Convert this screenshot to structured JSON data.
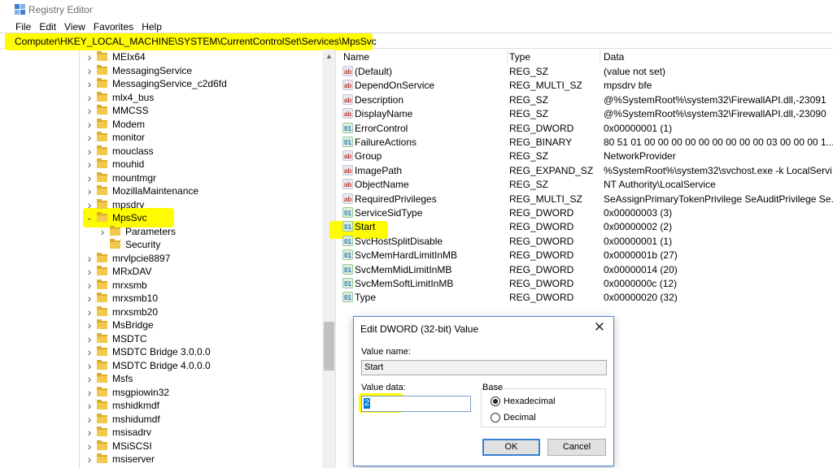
{
  "window": {
    "title": "Registry Editor"
  },
  "menu": {
    "file": "File",
    "edit": "Edit",
    "view": "View",
    "favorites": "Favorites",
    "help": "Help"
  },
  "address": {
    "path": "Computer\\HKEY_LOCAL_MACHINE\\SYSTEM\\CurrentControlSet\\Services\\MpsSvc"
  },
  "tree": {
    "items": [
      {
        "label": "MEIx64",
        "expanded": false,
        "has_children": true
      },
      {
        "label": "MessagingService",
        "expanded": false,
        "has_children": true
      },
      {
        "label": "MessagingService_c2d6fd",
        "expanded": false,
        "has_children": true
      },
      {
        "label": "mlx4_bus",
        "expanded": false,
        "has_children": true
      },
      {
        "label": "MMCSS",
        "expanded": false,
        "has_children": true
      },
      {
        "label": "Modem",
        "expanded": false,
        "has_children": true
      },
      {
        "label": "monitor",
        "expanded": false,
        "has_children": true
      },
      {
        "label": "mouclass",
        "expanded": false,
        "has_children": true
      },
      {
        "label": "mouhid",
        "expanded": false,
        "has_children": true
      },
      {
        "label": "mountmgr",
        "expanded": false,
        "has_children": true
      },
      {
        "label": "MozillaMaintenance",
        "expanded": false,
        "has_children": true
      },
      {
        "label": "mpsdrv",
        "expanded": false,
        "has_children": true
      },
      {
        "label": "MpsSvc",
        "expanded": true,
        "has_children": true,
        "selected": true
      },
      {
        "label": "Parameters",
        "expanded": false,
        "has_children": true,
        "child": true
      },
      {
        "label": "Security",
        "expanded": false,
        "has_children": false,
        "child": true
      },
      {
        "label": "mrvlpcie8897",
        "expanded": false,
        "has_children": true
      },
      {
        "label": "MRxDAV",
        "expanded": false,
        "has_children": true
      },
      {
        "label": "mrxsmb",
        "expanded": false,
        "has_children": true
      },
      {
        "label": "mrxsmb10",
        "expanded": false,
        "has_children": true
      },
      {
        "label": "mrxsmb20",
        "expanded": false,
        "has_children": true
      },
      {
        "label": "MsBridge",
        "expanded": false,
        "has_children": true
      },
      {
        "label": "MSDTC",
        "expanded": false,
        "has_children": true
      },
      {
        "label": "MSDTC Bridge 3.0.0.0",
        "expanded": false,
        "has_children": true
      },
      {
        "label": "MSDTC Bridge 4.0.0.0",
        "expanded": false,
        "has_children": true
      },
      {
        "label": "Msfs",
        "expanded": false,
        "has_children": true
      },
      {
        "label": "msgpiowin32",
        "expanded": false,
        "has_children": true
      },
      {
        "label": "mshidkmdf",
        "expanded": false,
        "has_children": true
      },
      {
        "label": "mshidumdf",
        "expanded": false,
        "has_children": true
      },
      {
        "label": "msisadrv",
        "expanded": false,
        "has_children": true
      },
      {
        "label": "MSiSCSI",
        "expanded": false,
        "has_children": true
      },
      {
        "label": "msiserver",
        "expanded": false,
        "has_children": true
      }
    ]
  },
  "values": {
    "headers": {
      "name": "Name",
      "type": "Type",
      "data": "Data"
    },
    "rows": [
      {
        "name": "(Default)",
        "type": "REG_SZ",
        "data": "(value not set)",
        "icon": "string-value-icon"
      },
      {
        "name": "DependOnService",
        "type": "REG_MULTI_SZ",
        "data": "mpsdrv bfe",
        "icon": "string-value-icon"
      },
      {
        "name": "Description",
        "type": "REG_SZ",
        "data": "@%SystemRoot%\\system32\\FirewallAPI.dll,-23091",
        "icon": "string-value-icon"
      },
      {
        "name": "DisplayName",
        "type": "REG_SZ",
        "data": "@%SystemRoot%\\system32\\FirewallAPI.dll,-23090",
        "icon": "string-value-icon"
      },
      {
        "name": "ErrorControl",
        "type": "REG_DWORD",
        "data": "0x00000001 (1)",
        "icon": "binary-value-icon"
      },
      {
        "name": "FailureActions",
        "type": "REG_BINARY",
        "data": "80 51 01 00 00 00 00 00 00 00 00 00 03 00 00 00 1...",
        "icon": "binary-value-icon"
      },
      {
        "name": "Group",
        "type": "REG_SZ",
        "data": "NetworkProvider",
        "icon": "string-value-icon"
      },
      {
        "name": "ImagePath",
        "type": "REG_EXPAND_SZ",
        "data": "%SystemRoot%\\system32\\svchost.exe -k LocalServi...",
        "icon": "string-value-icon"
      },
      {
        "name": "ObjectName",
        "type": "REG_SZ",
        "data": "NT Authority\\LocalService",
        "icon": "string-value-icon"
      },
      {
        "name": "RequiredPrivileges",
        "type": "REG_MULTI_SZ",
        "data": "SeAssignPrimaryTokenPrivilege SeAuditPrivilege Se...",
        "icon": "string-value-icon"
      },
      {
        "name": "ServiceSidType",
        "type": "REG_DWORD",
        "data": "0x00000003 (3)",
        "icon": "binary-value-icon"
      },
      {
        "name": "Start",
        "type": "REG_DWORD",
        "data": "0x00000002 (2)",
        "icon": "binary-value-icon"
      },
      {
        "name": "SvcHostSplitDisable",
        "type": "REG_DWORD",
        "data": "0x00000001 (1)",
        "icon": "binary-value-icon"
      },
      {
        "name": "SvcMemHardLimitInMB",
        "type": "REG_DWORD",
        "data": "0x0000001b (27)",
        "icon": "binary-value-icon"
      },
      {
        "name": "SvcMemMidLimitInMB",
        "type": "REG_DWORD",
        "data": "0x00000014 (20)",
        "icon": "binary-value-icon"
      },
      {
        "name": "SvcMemSoftLimitInMB",
        "type": "REG_DWORD",
        "data": "0x0000000c (12)",
        "icon": "binary-value-icon"
      },
      {
        "name": "Type",
        "type": "REG_DWORD",
        "data": "0x00000020 (32)",
        "icon": "binary-value-icon"
      }
    ]
  },
  "dialog": {
    "title": "Edit DWORD (32-bit) Value",
    "value_name_label": "Value name:",
    "value_name": "Start",
    "value_data_label": "Value data:",
    "value_data": "2",
    "base_label": "Base",
    "hex_label": "Hexadecimal",
    "dec_label": "Decimal",
    "hex_selected": true,
    "ok_label": "OK",
    "cancel_label": "Cancel"
  },
  "colors": {
    "highlight": "#fffb00",
    "selection": "#0078d7",
    "folder": "#f2c94c"
  }
}
